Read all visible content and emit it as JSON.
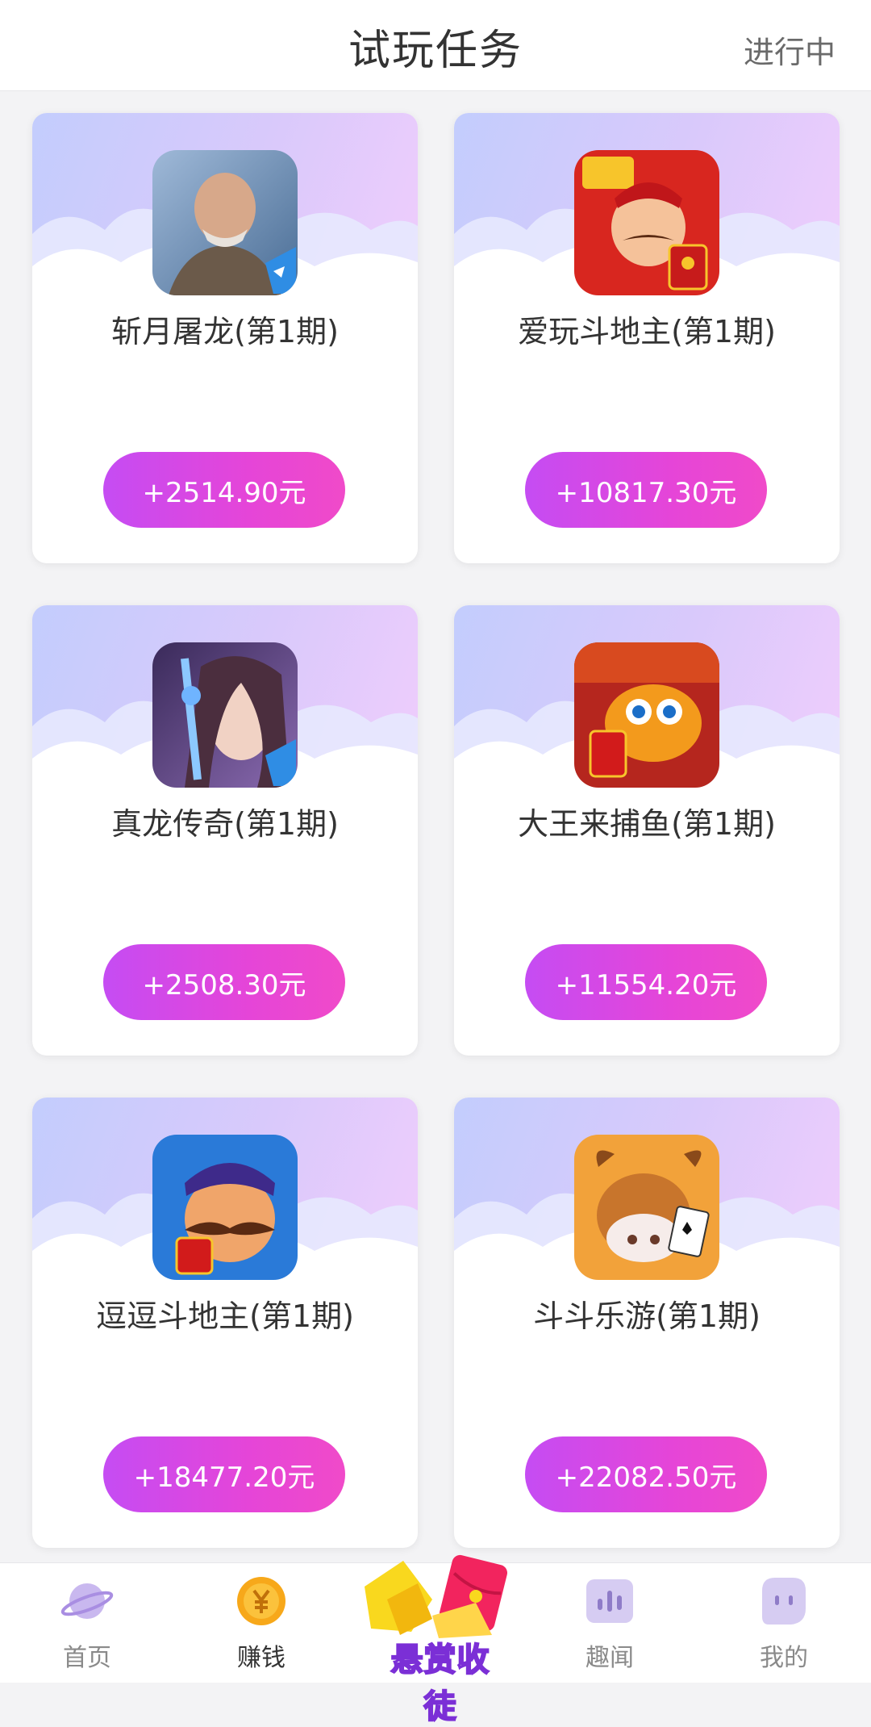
{
  "header": {
    "title": "试玩任务",
    "status_link": "进行中"
  },
  "tasks": [
    {
      "name": "斩月屠龙(第1期)",
      "reward": "+2514.90元",
      "icon": "game-warrior-icon"
    },
    {
      "name": "爱玩斗地主(第1期)",
      "reward": "+10817.30元",
      "icon": "landlord-redpacket-icon"
    },
    {
      "name": "真龙传奇(第1期)",
      "reward": "+2508.30元",
      "icon": "fantasy-heroine-icon"
    },
    {
      "name": "大王来捕鱼(第1期)",
      "reward": "+11554.20元",
      "icon": "fish-redpacket-icon"
    },
    {
      "name": "逗逗斗地主(第1期)",
      "reward": "+18477.20元",
      "icon": "mustache-redpacket-icon"
    },
    {
      "name": "斗斗乐游(第1期)",
      "reward": "+22082.50元",
      "icon": "cow-poker-icon"
    }
  ],
  "tabbar": {
    "items": [
      {
        "label": "首页",
        "icon": "planet-icon"
      },
      {
        "label": "赚钱",
        "icon": "coin-icon"
      },
      {
        "label": "趣闻",
        "icon": "audio-bars-icon"
      },
      {
        "label": "我的",
        "icon": "ghost-face-icon"
      }
    ],
    "promo_label": "悬赏收徒"
  },
  "colors": {
    "reward_gradient_start": "#c54cf3",
    "reward_gradient_end": "#f04ac9",
    "banner_start": "#c3cdfd",
    "banner_end": "#efcdfc"
  }
}
